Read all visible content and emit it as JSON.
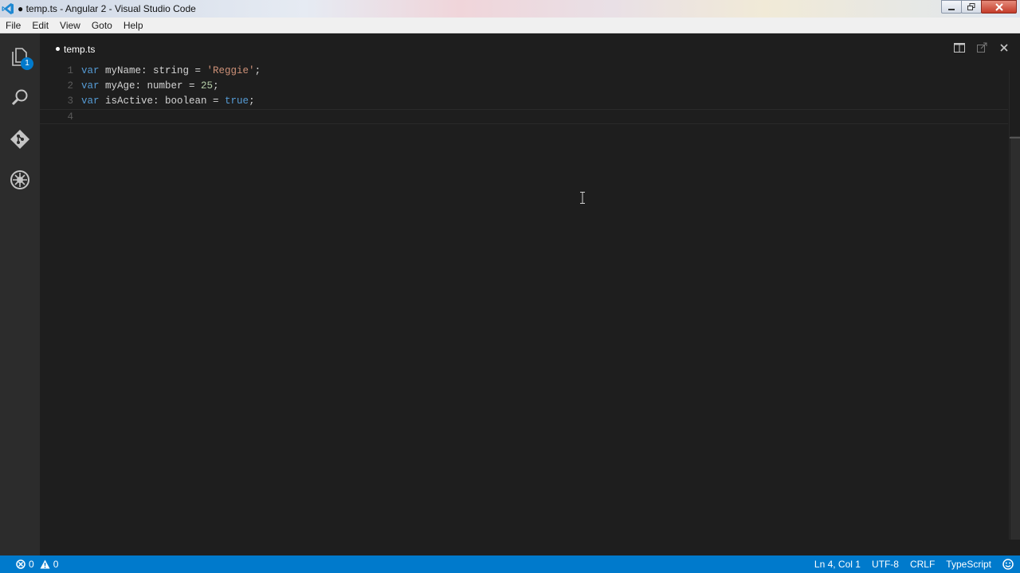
{
  "window": {
    "title": "● temp.ts - Angular 2 - Visual Studio Code"
  },
  "menu": [
    "File",
    "Edit",
    "View",
    "Goto",
    "Help"
  ],
  "activity": {
    "explorer_badge": "1"
  },
  "tab": {
    "title": "temp.ts"
  },
  "code_lines": [
    {
      "n": "1",
      "parts": [
        [
          "kw",
          "var"
        ],
        [
          "t",
          " myName: string = "
        ],
        [
          "str",
          "'Reggie'"
        ],
        [
          "t",
          ";"
        ]
      ]
    },
    {
      "n": "2",
      "parts": [
        [
          "kw",
          "var"
        ],
        [
          "t",
          " myAge: number = "
        ],
        [
          "num",
          "25"
        ],
        [
          "t",
          ";"
        ]
      ]
    },
    {
      "n": "3",
      "parts": [
        [
          "kw",
          "var"
        ],
        [
          "t",
          " isActive: boolean = "
        ],
        [
          "kw",
          "true"
        ],
        [
          "t",
          ";"
        ]
      ]
    },
    {
      "n": "4",
      "parts": []
    }
  ],
  "status": {
    "errors": "0",
    "warnings": "0",
    "position": "Ln 4, Col 1",
    "encoding": "UTF-8",
    "eol": "CRLF",
    "language": "TypeScript"
  },
  "colors": {
    "accent": "#007acc",
    "keyword": "#569cd6",
    "string": "#ce9178",
    "number": "#b5cea8"
  }
}
